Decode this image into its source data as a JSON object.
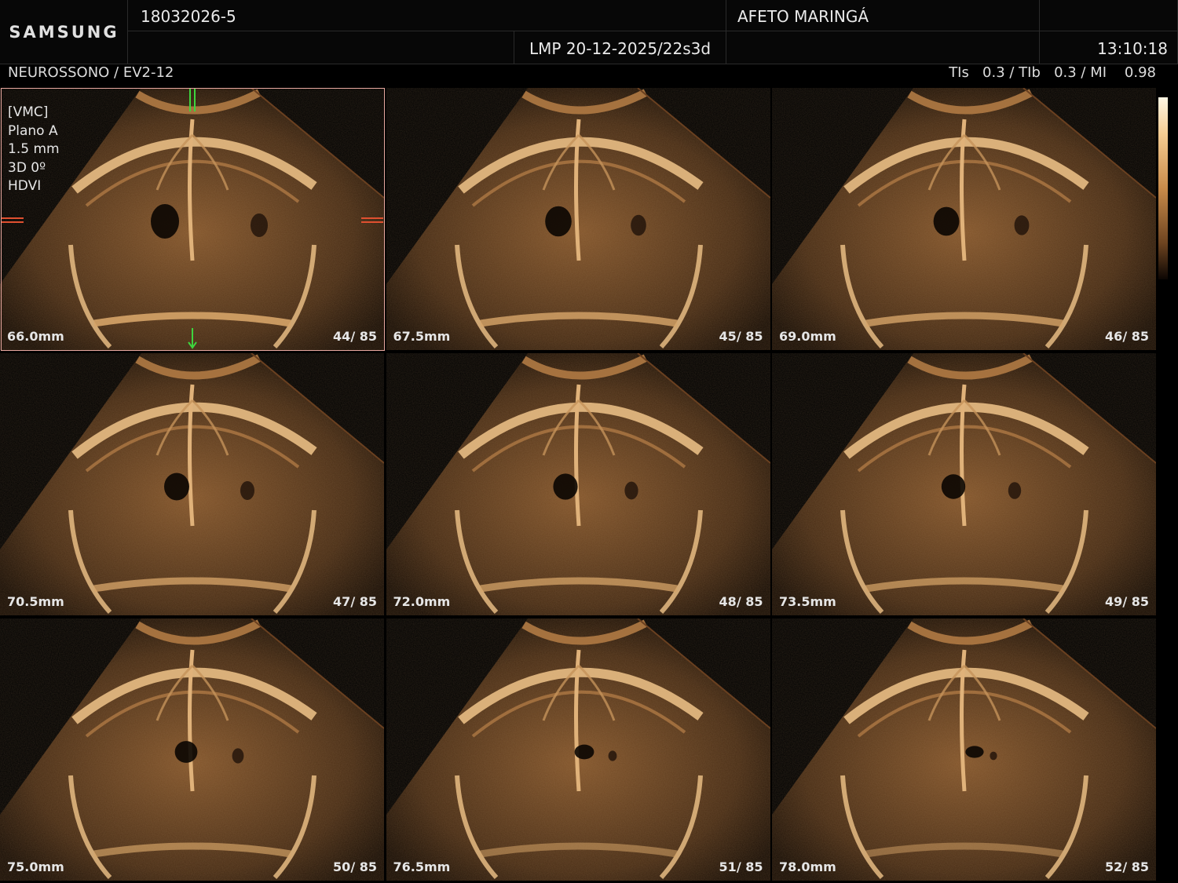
{
  "header": {
    "brand": "SAMSUNG",
    "patient_id": "18032026-5",
    "institution": "AFETO MARINGÁ",
    "lmp": "LMP 20-12-2025/22s3d",
    "time": "13:10:18"
  },
  "subheader": {
    "preset": "NEUROSSONO / EV2-12",
    "indices": "TIs   0.3 / TIb   0.3 / MI    0.98"
  },
  "active_panel_info": [
    "[VMC]",
    "Plano A",
    "1.5 mm",
    "3D 0º",
    "HDVI"
  ],
  "tiles": [
    {
      "depth": "66.0mm",
      "frame": "44/ 85",
      "vent": 1.0
    },
    {
      "depth": "67.5mm",
      "frame": "45/ 85",
      "vent": 0.85
    },
    {
      "depth": "69.0mm",
      "frame": "46/ 85",
      "vent": 0.8
    },
    {
      "depth": "70.5mm",
      "frame": "47/ 85",
      "vent": 0.75
    },
    {
      "depth": "72.0mm",
      "frame": "48/ 85",
      "vent": 0.7
    },
    {
      "depth": "73.5mm",
      "frame": "49/ 85",
      "vent": 0.65
    },
    {
      "depth": "75.0mm",
      "frame": "50/ 85",
      "vent": 0.55
    },
    {
      "depth": "76.5mm",
      "frame": "51/ 85",
      "vent": 0.3
    },
    {
      "depth": "78.0mm",
      "frame": "52/ 85",
      "vent": 0.2
    }
  ],
  "colors": {
    "tissue": "#8a5a2e",
    "bone": "#f0c48a",
    "active_border": "#e8a8a0",
    "marker_green": "#3ed43e",
    "marker_red": "#e05030"
  }
}
